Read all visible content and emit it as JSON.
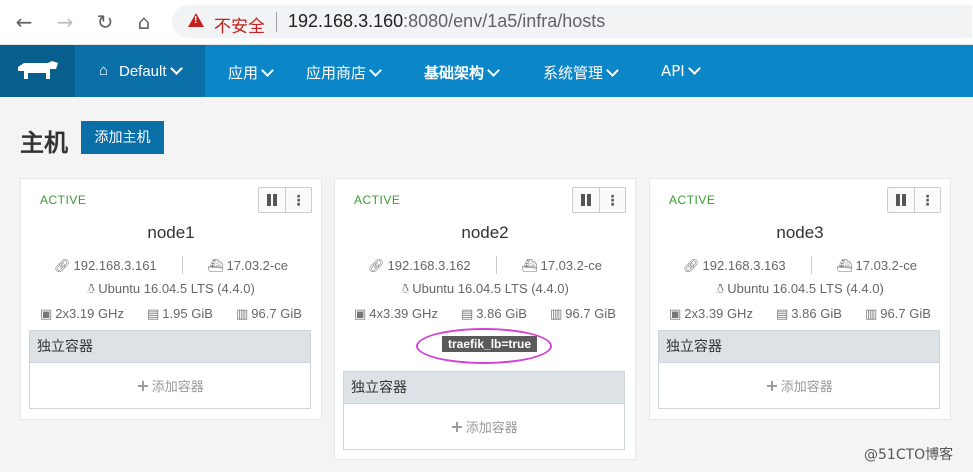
{
  "browser": {
    "insecure_label": "不安全",
    "url_host": "192.168.3.160",
    "url_rest": ":8080/env/1a5/infra/hosts"
  },
  "header": {
    "environment": "Default",
    "nav": [
      {
        "label": "应用"
      },
      {
        "label": "应用商店"
      },
      {
        "label": "基础架构"
      },
      {
        "label": "系统管理"
      },
      {
        "label": "API"
      }
    ]
  },
  "page": {
    "title": "主机",
    "add_host_label": "添加主机"
  },
  "hosts": [
    {
      "status": "ACTIVE",
      "name": "node1",
      "ip": "192.168.3.161",
      "docker": "17.03.2-ce",
      "os": "Ubuntu 16.04.5 LTS (4.4.0)",
      "cpu": "2x3.19 GHz",
      "memory": "1.95 GiB",
      "disk": "96.7 GiB",
      "label": null
    },
    {
      "status": "ACTIVE",
      "name": "node2",
      "ip": "192.168.3.162",
      "docker": "17.03.2-ce",
      "os": "Ubuntu 16.04.5 LTS (4.4.0)",
      "cpu": "4x3.39 GHz",
      "memory": "3.86 GiB",
      "disk": "96.7 GiB",
      "label": "traefik_lb=true"
    },
    {
      "status": "ACTIVE",
      "name": "node3",
      "ip": "192.168.3.163",
      "docker": "17.03.2-ce",
      "os": "Ubuntu 16.04.5 LTS (4.4.0)",
      "cpu": "2x3.39 GHz",
      "memory": "3.86 GiB",
      "disk": "96.7 GiB",
      "label": null
    }
  ],
  "standalone": {
    "header": "独立容器",
    "add_label": "添加容器"
  },
  "watermark": "@51CTO博客",
  "colors": {
    "brand": "#0b86c8",
    "active": "#3a9b35",
    "highlight": "#d53fd6"
  }
}
